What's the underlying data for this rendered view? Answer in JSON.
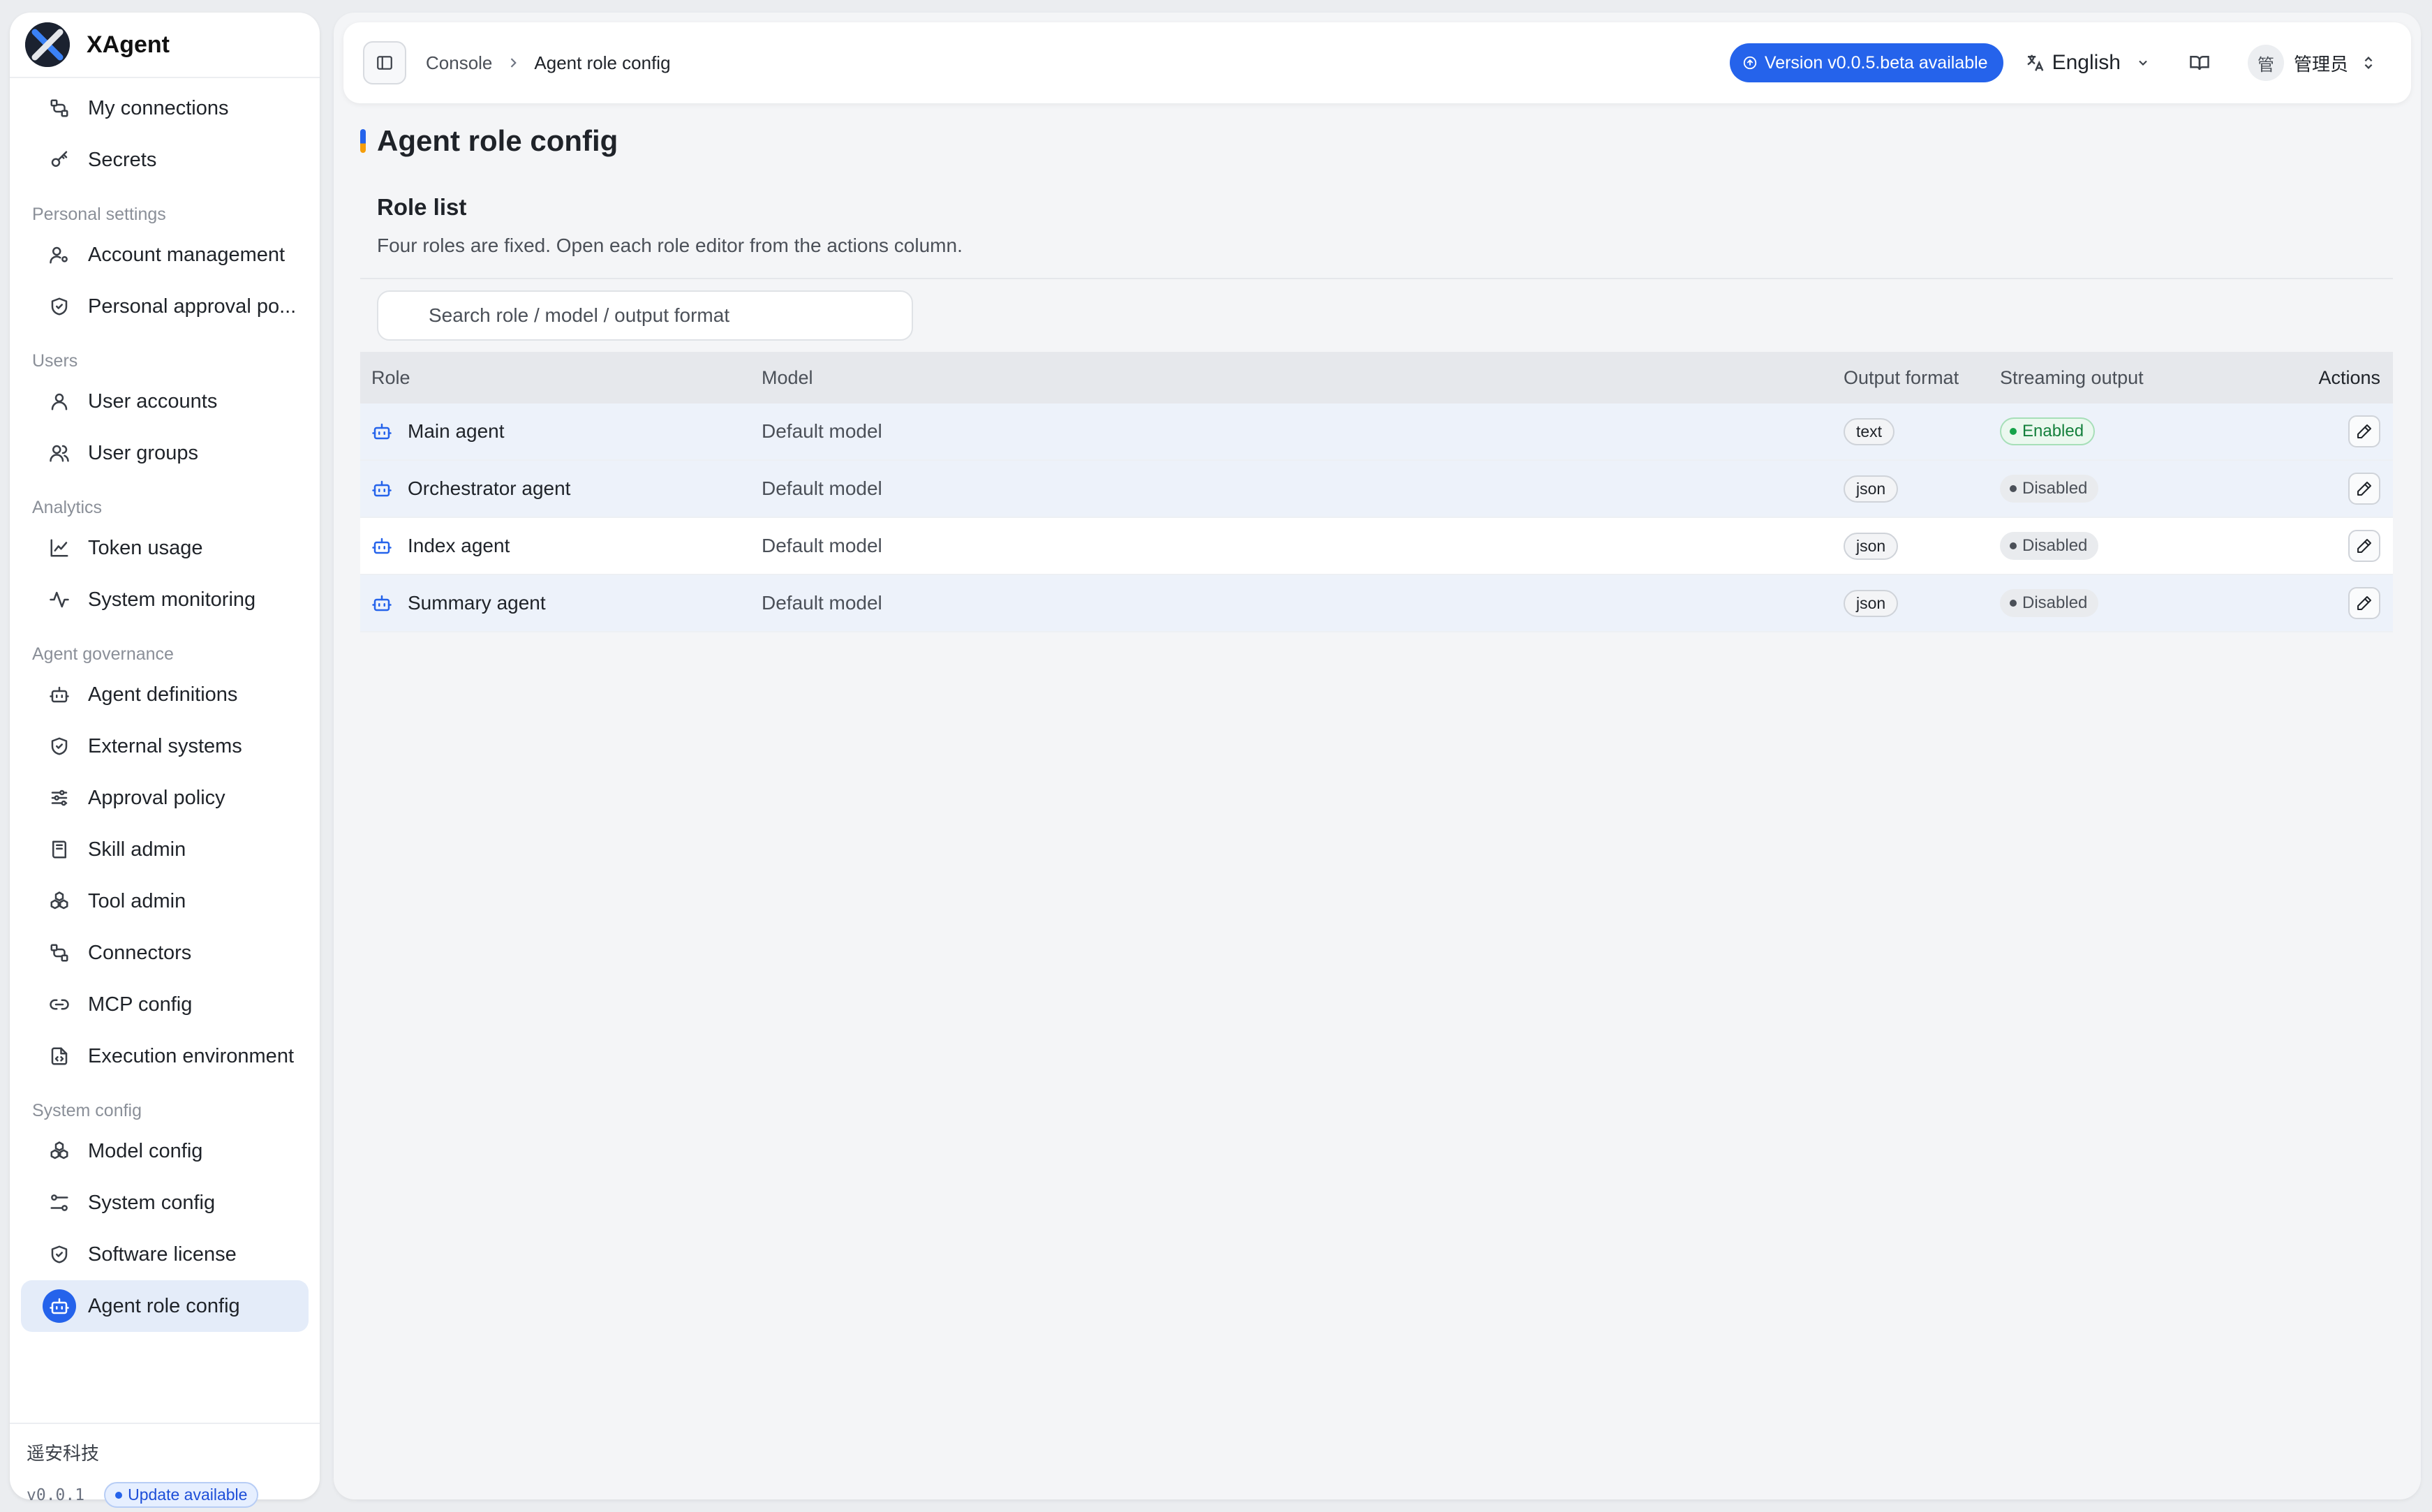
{
  "app": {
    "name": "XAgent"
  },
  "sidebar": {
    "groups": [
      {
        "title": "",
        "items": [
          {
            "label": "My connections",
            "icon": "connections-icon"
          },
          {
            "label": "Secrets",
            "icon": "key-icon"
          }
        ]
      },
      {
        "title": "Personal settings",
        "items": [
          {
            "label": "Account management",
            "icon": "user-gear-icon"
          },
          {
            "label": "Personal approval po...",
            "icon": "shield-icon"
          }
        ]
      },
      {
        "title": "Users",
        "items": [
          {
            "label": "User accounts",
            "icon": "user-icon"
          },
          {
            "label": "User groups",
            "icon": "users-icon"
          }
        ]
      },
      {
        "title": "Analytics",
        "items": [
          {
            "label": "Token usage",
            "icon": "line-chart-icon"
          },
          {
            "label": "System monitoring",
            "icon": "activity-icon"
          }
        ]
      },
      {
        "title": "Agent governance",
        "items": [
          {
            "label": "Agent definitions",
            "icon": "bot-icon"
          },
          {
            "label": "External systems",
            "icon": "shield-icon"
          },
          {
            "label": "Approval policy",
            "icon": "sliders-icon"
          },
          {
            "label": "Skill admin",
            "icon": "book-icon"
          },
          {
            "label": "Tool admin",
            "icon": "cubes-icon"
          },
          {
            "label": "Connectors",
            "icon": "connections-icon"
          },
          {
            "label": "MCP config",
            "icon": "link-icon"
          },
          {
            "label": "Execution environment",
            "icon": "file-code-icon"
          }
        ]
      },
      {
        "title": "System config",
        "items": [
          {
            "label": "Model config",
            "icon": "cubes-icon"
          },
          {
            "label": "System config",
            "icon": "settings-icon"
          },
          {
            "label": "Software license",
            "icon": "shield-icon"
          },
          {
            "label": "Agent role config",
            "icon": "bot-icon",
            "active": true
          }
        ]
      }
    ],
    "footer": {
      "org": "遥安科技",
      "version": "v0.0.1",
      "update_label": "Update available"
    }
  },
  "topbar": {
    "breadcrumb": {
      "root": "Console",
      "current": "Agent role config"
    },
    "version_pill": "Version v0.0.5.beta available",
    "language": "English",
    "user": {
      "avatar": "管",
      "name": "管理员"
    }
  },
  "page": {
    "title": "Agent role config",
    "section_title": "Role list",
    "section_desc": "Four roles are fixed. Open each role editor from the actions column.",
    "search_placeholder": "Search role / model / output format"
  },
  "table": {
    "headers": {
      "role": "Role",
      "model": "Model",
      "format": "Output format",
      "stream": "Streaming output",
      "actions": "Actions"
    },
    "rows": [
      {
        "role": "Main agent",
        "model": "Default model",
        "format": "text",
        "stream": "Enabled",
        "stream_on": true
      },
      {
        "role": "Orchestrator agent",
        "model": "Default model",
        "format": "json",
        "stream": "Disabled",
        "stream_on": false
      },
      {
        "role": "Index agent",
        "model": "Default model",
        "format": "json",
        "stream": "Disabled",
        "stream_on": false
      },
      {
        "role": "Summary agent",
        "model": "Default model",
        "format": "json",
        "stream": "Disabled",
        "stream_on": false
      }
    ]
  },
  "colors": {
    "accent": "#2563eb",
    "enabled": "#16a34a",
    "title_accent_secondary": "#f59e0b"
  }
}
